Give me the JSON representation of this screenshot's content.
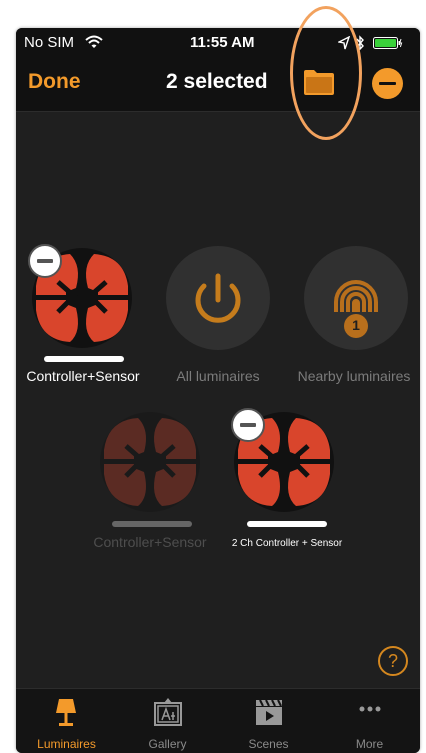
{
  "status_bar": {
    "carrier": "No SIM",
    "time": "11:55 AM"
  },
  "nav": {
    "done_label": "Done",
    "title": "2 selected",
    "folder_icon": "folder-icon",
    "remove_icon": "minus-circle-icon"
  },
  "tiles": [
    {
      "label": "Controller+Sensor",
      "icon": "controller-sensor-icon",
      "selected": true
    },
    {
      "label": "All luminaires",
      "icon": "power-icon",
      "selected": false
    },
    {
      "label": "Nearby luminaires",
      "icon": "nearby-signal-icon",
      "badge": "1",
      "selected": false
    },
    {
      "label": "Controller+Sensor",
      "icon": "controller-sensor-icon",
      "selected": false,
      "dimmed": true
    },
    {
      "label": "2 Ch Controller + Sensor",
      "icon": "controller-sensor-icon",
      "selected": true
    }
  ],
  "help_label": "?",
  "tabbar": {
    "items": [
      {
        "label": "Luminaires",
        "icon": "lamp-icon",
        "active": true
      },
      {
        "label": "Gallery",
        "icon": "gallery-icon",
        "active": false
      },
      {
        "label": "Scenes",
        "icon": "clapperboard-icon",
        "active": false
      },
      {
        "label": "More",
        "icon": "more-dots-icon",
        "active": false
      }
    ]
  },
  "colors": {
    "accent": "#f39a2b",
    "background": "#1f1f1f",
    "tile_red": "#d9452c",
    "annotation_ring": "#f2a25e"
  }
}
